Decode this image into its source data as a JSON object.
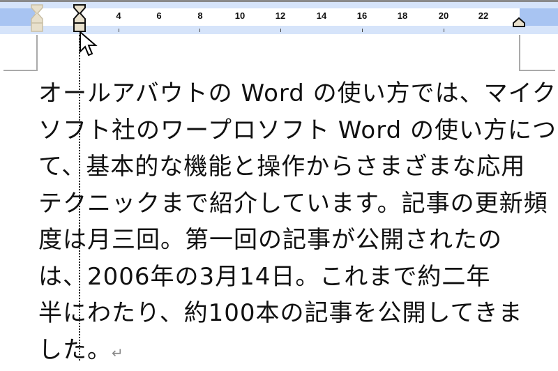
{
  "ruler": {
    "labels": [
      "4",
      "6",
      "8",
      "10",
      "12",
      "14",
      "16",
      "18",
      "20",
      "22"
    ]
  },
  "document": {
    "lines": [
      "オールアバウトの Word の使い方では、マイクロ",
      "ソフト社のワープロソフト Word の使い方につい",
      "て、基本的な機能と操作からさまざまな応用",
      "テクニックまで紹介しています。記事の更新頻",
      "度は月三回。第一回の記事が公開されたの",
      "は、2006年の3月14日。これまで約二年",
      "半にわたり、約100本の記事を公開してきま",
      "した。"
    ],
    "paragraph_mark": "↵"
  }
}
